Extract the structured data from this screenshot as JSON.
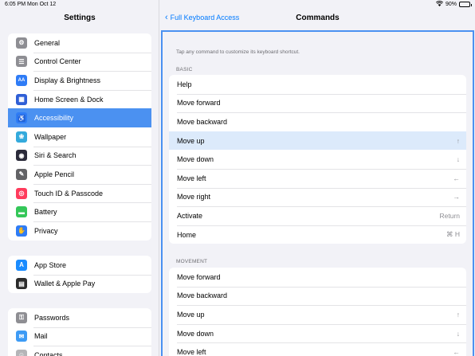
{
  "status": {
    "time": "6:05 PM  Mon Oct 12",
    "battery": "90%",
    "wifi_icon": "wifi-icon"
  },
  "sidebar": {
    "title": "Settings",
    "groups": [
      [
        {
          "label": "General",
          "icon": "gear-icon",
          "color": "#8e8e93",
          "glyph": "⚙"
        },
        {
          "label": "Control Center",
          "icon": "toggles-icon",
          "color": "#8e8e93",
          "glyph": "☰"
        },
        {
          "label": "Display & Brightness",
          "icon": "text-size-icon",
          "color": "#2f7cf6",
          "glyph": "AA"
        },
        {
          "label": "Home Screen & Dock",
          "icon": "grid-icon",
          "color": "#2f5fd6",
          "glyph": "▦"
        },
        {
          "label": "Accessibility",
          "icon": "accessibility-icon",
          "color": "#2f7cf6",
          "glyph": "♿",
          "selected": true
        },
        {
          "label": "Wallpaper",
          "icon": "flower-icon",
          "color": "#34aadc",
          "glyph": "❀"
        },
        {
          "label": "Siri & Search",
          "icon": "siri-icon",
          "color": "#2b2b3a",
          "glyph": "◉"
        },
        {
          "label": "Apple Pencil",
          "icon": "pencil-icon",
          "color": "#636366",
          "glyph": "✎"
        },
        {
          "label": "Touch ID & Passcode",
          "icon": "fingerprint-icon",
          "color": "#ff3b5c",
          "glyph": "◎"
        },
        {
          "label": "Battery",
          "icon": "battery-icon",
          "color": "#34c759",
          "glyph": "▬"
        },
        {
          "label": "Privacy",
          "icon": "hand-icon",
          "color": "#2f7cf6",
          "glyph": "✋"
        }
      ],
      [
        {
          "label": "App Store",
          "icon": "app-store-icon",
          "color": "#1a8cff",
          "glyph": "A"
        },
        {
          "label": "Wallet & Apple Pay",
          "icon": "wallet-icon",
          "color": "#2b2b2b",
          "glyph": "▤"
        }
      ],
      [
        {
          "label": "Passwords",
          "icon": "key-icon",
          "color": "#8e8e93",
          "glyph": "⚿"
        },
        {
          "label": "Mail",
          "icon": "mail-icon",
          "color": "#3d9bf5",
          "glyph": "✉"
        },
        {
          "label": "Contacts",
          "icon": "contacts-icon",
          "color": "#b5b5b8",
          "glyph": "☺"
        }
      ]
    ]
  },
  "nav": {
    "back_label": "Full Keyboard Access",
    "title": "Commands"
  },
  "hint": "Tap any command to customize its keyboard shortcut.",
  "sections": [
    {
      "header": "BASIC",
      "rows": [
        {
          "label": "Help",
          "shortcut": ""
        },
        {
          "label": "Move forward",
          "shortcut": ""
        },
        {
          "label": "Move backward",
          "shortcut": ""
        },
        {
          "label": "Move up",
          "shortcut": "↑",
          "highlight": true
        },
        {
          "label": "Move down",
          "shortcut": "↓"
        },
        {
          "label": "Move left",
          "shortcut": "←"
        },
        {
          "label": "Move right",
          "shortcut": "→"
        },
        {
          "label": "Activate",
          "shortcut": "Return"
        },
        {
          "label": "Home",
          "shortcut": "⌘ H"
        }
      ]
    },
    {
      "header": "MOVEMENT",
      "rows": [
        {
          "label": "Move forward",
          "shortcut": ""
        },
        {
          "label": "Move backward",
          "shortcut": ""
        },
        {
          "label": "Move up",
          "shortcut": "↑"
        },
        {
          "label": "Move down",
          "shortcut": "↓"
        },
        {
          "label": "Move left",
          "shortcut": "←"
        }
      ]
    }
  ]
}
